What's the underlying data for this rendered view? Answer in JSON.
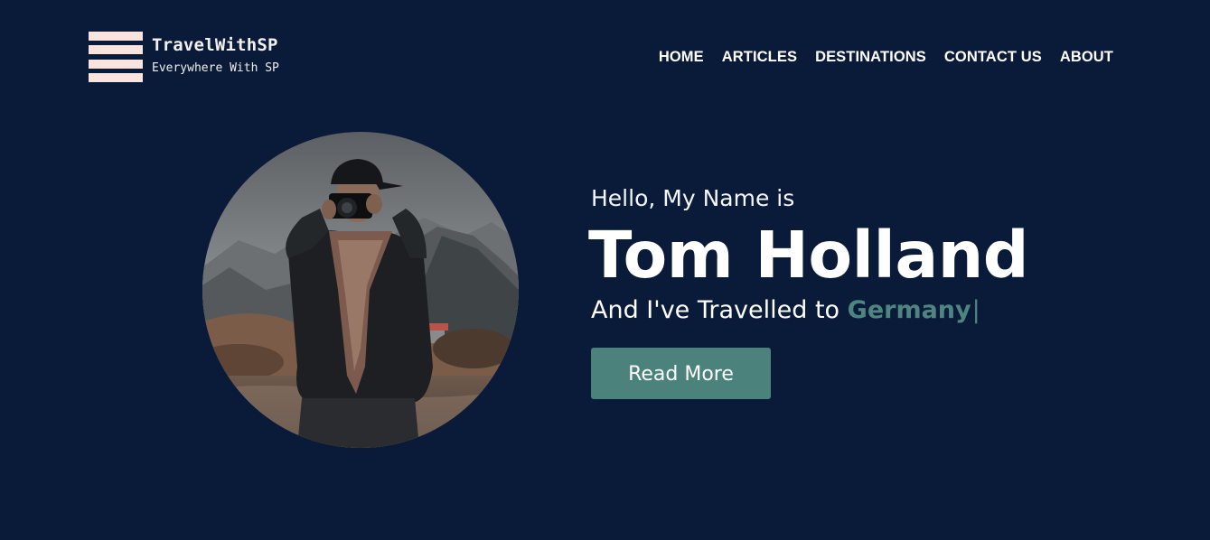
{
  "logo": {
    "title": "TravelWithSP",
    "subtitle": "Everywhere With SP",
    "icon": "hamburger-stripes-icon",
    "color": "#fbe3de"
  },
  "nav": {
    "items": [
      {
        "label": "HOME"
      },
      {
        "label": "ARTICLES"
      },
      {
        "label": "DESTINATIONS"
      },
      {
        "label": "CONTACT US"
      },
      {
        "label": "ABOUT"
      }
    ]
  },
  "hero": {
    "greeting": "Hello, My Name is",
    "name": "Tom Holland",
    "travelled_prefix": "And I've Travelled to ",
    "country": "Germany",
    "cursor": "|",
    "button_label": "Read More",
    "photo_subject": "photographer-with-camera",
    "accent_color": "#4b827b"
  },
  "colors": {
    "background": "#0a1b39",
    "text": "#ffffff",
    "accent": "#4f8580"
  }
}
